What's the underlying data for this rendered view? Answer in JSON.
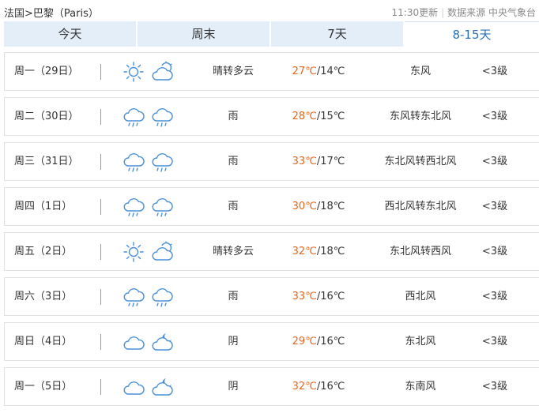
{
  "header": {
    "breadcrumb_country": "法国",
    "breadcrumb_sep": ">",
    "breadcrumb_city": "巴黎（Paris）",
    "updated": "11:30更新",
    "source_label": "数据来源 中央气象台"
  },
  "tabs": [
    {
      "label": "今天",
      "active": false
    },
    {
      "label": "周末",
      "active": false
    },
    {
      "label": "7天",
      "active": false
    },
    {
      "label": "8-15天",
      "active": true
    }
  ],
  "colors": {
    "high_temp": "#e8641a",
    "tab_bg": "#e3eef8",
    "active_tab_text": "#2b6fb6",
    "icon_stroke": "#4a90d9"
  },
  "days": [
    {
      "day": "周一（29日）",
      "icons": [
        "sun-icon",
        "cloud-sun-icon"
      ],
      "desc": "晴转多云",
      "high": "27℃",
      "low": "/14℃",
      "wind": "东风",
      "level": "<3级"
    },
    {
      "day": "周二（30日）",
      "icons": [
        "rain-icon",
        "rain-icon"
      ],
      "desc": "雨",
      "high": "28℃",
      "low": "/15℃",
      "wind": "东风转东北风",
      "level": "<3级"
    },
    {
      "day": "周三（31日）",
      "icons": [
        "rain-icon",
        "rain-icon"
      ],
      "desc": "雨",
      "high": "33℃",
      "low": "/17℃",
      "wind": "东北风转西北风",
      "level": "<3级"
    },
    {
      "day": "周四（1日）",
      "icons": [
        "rain-icon",
        "rain-icon"
      ],
      "desc": "雨",
      "high": "30℃",
      "low": "/18℃",
      "wind": "西北风转东北风",
      "level": "<3级"
    },
    {
      "day": "周五（2日）",
      "icons": [
        "sun-icon",
        "cloud-sun-icon"
      ],
      "desc": "晴转多云",
      "high": "32℃",
      "low": "/18℃",
      "wind": "东北风转西风",
      "level": "<3级"
    },
    {
      "day": "周六（3日）",
      "icons": [
        "rain-icon",
        "rain-icon"
      ],
      "desc": "雨",
      "high": "33℃",
      "low": "/16℃",
      "wind": "西北风",
      "level": "<3级"
    },
    {
      "day": "周日（4日）",
      "icons": [
        "cloud-icon",
        "cloud-moon-icon"
      ],
      "desc": "阴",
      "high": "29℃",
      "low": "/16℃",
      "wind": "东北风",
      "level": "<3级"
    },
    {
      "day": "周一（5日）",
      "icons": [
        "cloud-icon",
        "cloud-moon-icon"
      ],
      "desc": "阴",
      "high": "32℃",
      "low": "/16℃",
      "wind": "东南风",
      "level": "<3级"
    }
  ]
}
